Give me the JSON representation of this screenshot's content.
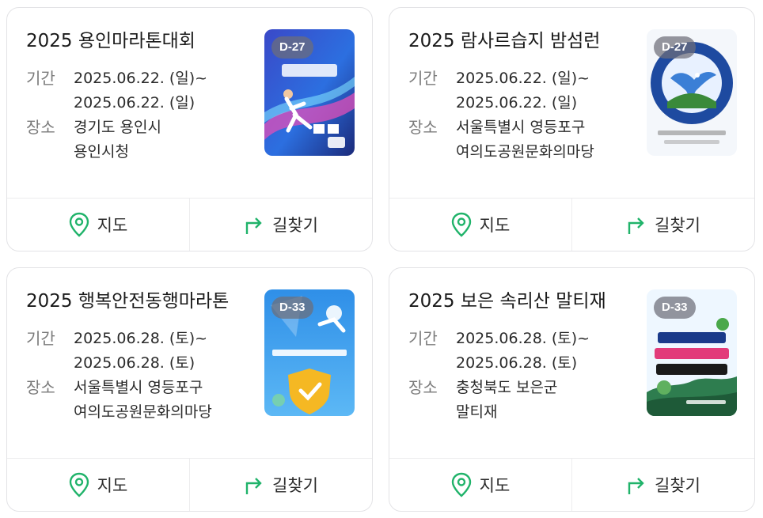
{
  "labels": {
    "period": "기간",
    "place": "장소",
    "map": "지도",
    "directions": "길찾기"
  },
  "colors": {
    "accent_green": "#20b36a",
    "dday_badge": "#6e6e78"
  },
  "icons": {
    "map": "location-pin-icon",
    "directions": "turn-arrow-icon"
  },
  "events": [
    {
      "title": "2025 용인마라톤대회",
      "start": "2025.06.22. (일)~",
      "end": "2025.06.22. (일)",
      "place_line1": "경기도 용인시",
      "place_line2": "용인시청",
      "dday": "D-27"
    },
    {
      "title": "2025 람사르습지 밤섬런",
      "start": "2025.06.22. (일)~",
      "end": "2025.06.22. (일)",
      "place_line1": "서울특별시 영등포구",
      "place_line2": "여의도공원문화의마당",
      "dday": "D-27"
    },
    {
      "title": "2025 행복안전동행마라톤",
      "start": "2025.06.28. (토)~",
      "end": "2025.06.28. (토)",
      "place_line1": "서울특별시 영등포구",
      "place_line2": "여의도공원문화의마당",
      "dday": "D-33"
    },
    {
      "title": "2025 보은 속리산 말티재",
      "start": "2025.06.28. (토)~",
      "end": "2025.06.28. (토)",
      "place_line1": "충청북도 보은군",
      "place_line2": "말티재",
      "dday": "D-33"
    }
  ]
}
